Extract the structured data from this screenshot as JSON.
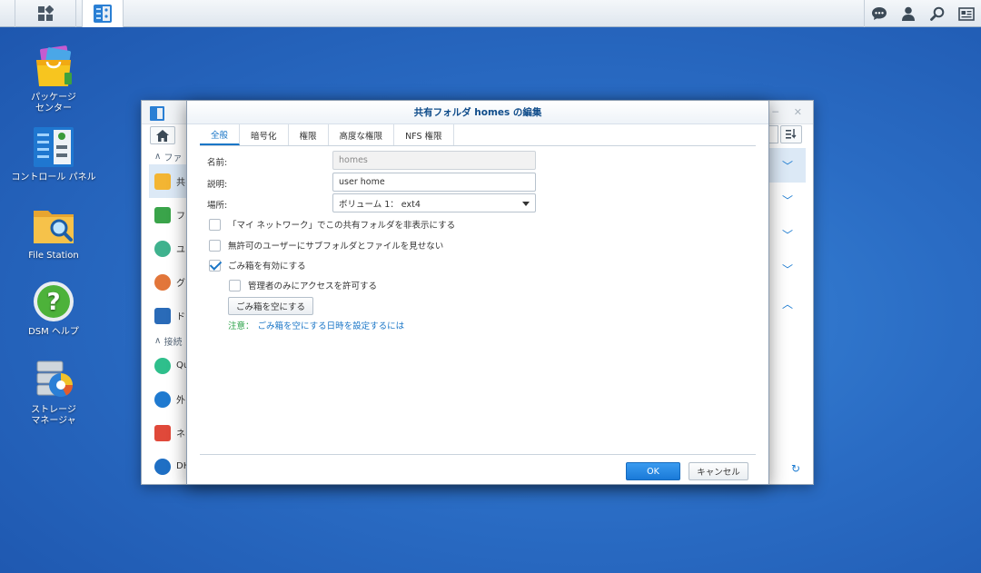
{
  "taskbar": {
    "main_menu_icon": "grid-icon",
    "open_app_icon": "control-panel-icon",
    "right_icons": [
      "chat-icon",
      "user-icon",
      "search-icon",
      "widgets-icon"
    ]
  },
  "desktop": {
    "icons": [
      {
        "label": "パッケージ\nセンター",
        "icon": "package-center-icon"
      },
      {
        "label": "コントロール パネル",
        "icon": "control-panel-icon"
      },
      {
        "label": "File Station",
        "icon": "file-station-icon"
      },
      {
        "label": "DSM ヘルプ",
        "icon": "dsm-help-icon"
      },
      {
        "label": "ストレージ\nマネージャ",
        "icon": "storage-manager-icon"
      }
    ]
  },
  "control_panel": {
    "sidebar": {
      "section1": "ファ",
      "items1": [
        "共",
        "フ",
        "ユ",
        "グ",
        "ド"
      ],
      "section2": "接続",
      "items2": [
        "Qu",
        "外",
        "ネ",
        "DH"
      ]
    }
  },
  "dialog": {
    "title": "共有フォルダ homes の編集",
    "tabs": [
      "全般",
      "暗号化",
      "権限",
      "高度な権限",
      "NFS 権限"
    ],
    "active_tab": 0,
    "form": {
      "name_label": "名前:",
      "name_value": "homes",
      "desc_label": "説明:",
      "desc_value": "user home",
      "location_label": "場所:",
      "location_value": "ボリューム 1： ext4"
    },
    "checkboxes": {
      "hide_network": {
        "label": "「マイ ネットワーク」でこの共有フォルダを非表示にする",
        "checked": false
      },
      "hide_subfolders": {
        "label": "無許可のユーザーにサブフォルダとファイルを見せない",
        "checked": false
      },
      "recycle_bin": {
        "label": "ごみ箱を有効にする",
        "checked": true
      },
      "admin_only": {
        "label": "管理者のみにアクセスを許可する",
        "checked": false
      }
    },
    "empty_bin_button": "ごみ箱を空にする",
    "note_label": "注意：",
    "note_link": "ごみ箱を空にする日時を設定するには",
    "ok_button": "OK",
    "cancel_button": "キャンセル"
  },
  "colors": {
    "accent": "#1a76c7",
    "note_green": "#27a045",
    "desktop_bg": "#2a6cc4"
  }
}
